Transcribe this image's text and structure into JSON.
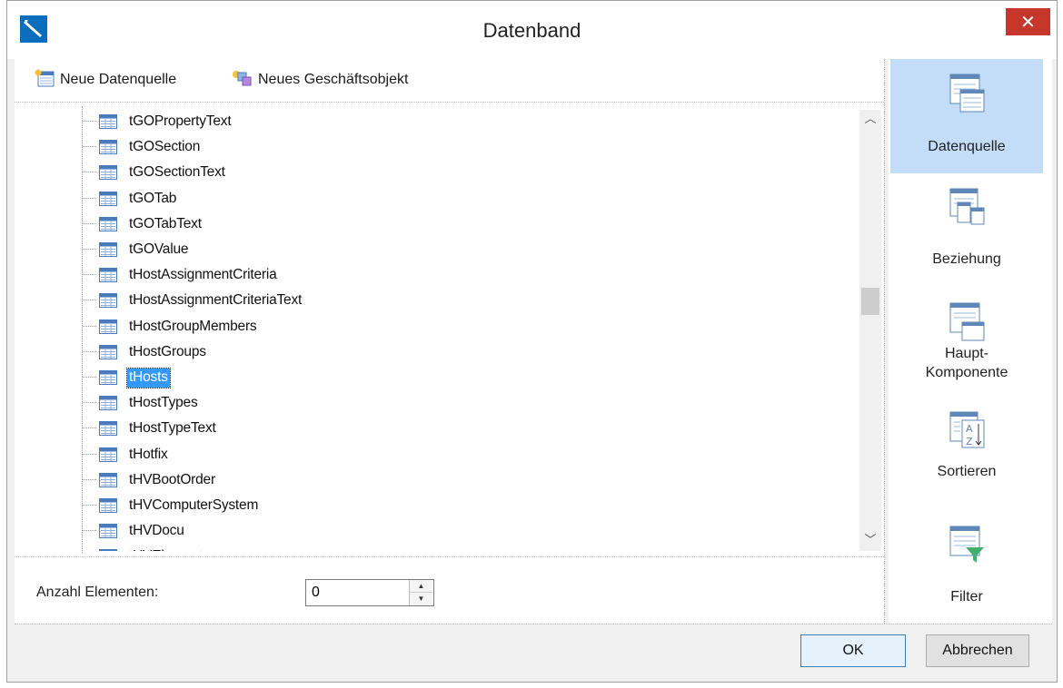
{
  "window": {
    "title": "Datenband",
    "close_glyph": "✕"
  },
  "toolbar": {
    "new_datasource_label": "Neue Datenquelle",
    "new_business_object_label": "Neues Geschäftsobjekt"
  },
  "tree": {
    "items": [
      {
        "label": "tGOPropertyText",
        "selected": false
      },
      {
        "label": "tGOSection",
        "selected": false
      },
      {
        "label": "tGOSectionText",
        "selected": false
      },
      {
        "label": "tGOTab",
        "selected": false
      },
      {
        "label": "tGOTabText",
        "selected": false
      },
      {
        "label": "tGOValue",
        "selected": false
      },
      {
        "label": "tHostAssignmentCriteria",
        "selected": false
      },
      {
        "label": "tHostAssignmentCriteriaText",
        "selected": false
      },
      {
        "label": "tHostGroupMembers",
        "selected": false
      },
      {
        "label": "tHostGroups",
        "selected": false
      },
      {
        "label": "tHosts",
        "selected": true
      },
      {
        "label": "tHostTypes",
        "selected": false
      },
      {
        "label": "tHostTypeText",
        "selected": false
      },
      {
        "label": "tHotfix",
        "selected": false
      },
      {
        "label": "tHVBootOrder",
        "selected": false
      },
      {
        "label": "tHVComputerSystem",
        "selected": false
      },
      {
        "label": "tHVDocu",
        "selected": false
      },
      {
        "label": "tHVElement",
        "selected": false
      }
    ],
    "item_icon": "table-icon"
  },
  "count": {
    "label": "Anzahl Elementen:",
    "value": "0"
  },
  "nav": {
    "items": [
      {
        "id": "datasource",
        "label": "Datenquelle",
        "icon": "datasource-icon",
        "active": true
      },
      {
        "id": "relation",
        "label": "Beziehung",
        "icon": "relation-icon",
        "active": false
      },
      {
        "id": "master",
        "label": "Haupt-\nKomponente",
        "icon": "master-component-icon",
        "active": false
      },
      {
        "id": "sort",
        "label": "Sortieren",
        "icon": "sort-icon",
        "active": false
      },
      {
        "id": "filter",
        "label": "Filter",
        "icon": "filter-icon",
        "active": false
      }
    ]
  },
  "buttons": {
    "ok_label": "OK",
    "cancel_label": "Abbrechen"
  },
  "colors": {
    "accent": "#3399ff",
    "nav_active": "#c3dcf7",
    "close": "#c7362b"
  }
}
